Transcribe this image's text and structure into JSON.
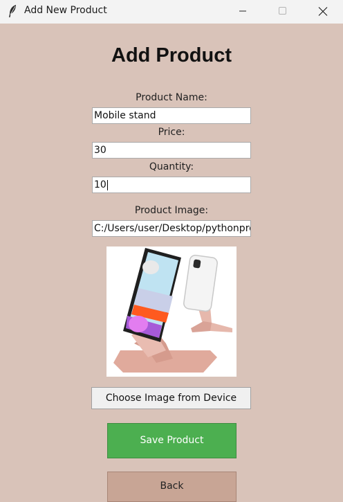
{
  "window": {
    "title": "Add New Product",
    "icon": "feather-icon"
  },
  "form": {
    "heading": "Add Product",
    "name_label": "Product Name:",
    "name_value": "Mobile stand",
    "price_label": "Price:",
    "price_value": "30",
    "quantity_label": "Quantity:",
    "quantity_value": "10",
    "image_label": "Product Image:",
    "image_path": "C:/Users/user/Desktop/pythonproj"
  },
  "buttons": {
    "choose_image": "Choose Image from Device",
    "save": "Save Product",
    "back": "Back"
  },
  "colors": {
    "background": "#d9c3b9",
    "save_button": "#4caf50",
    "back_button": "#c8a595"
  }
}
